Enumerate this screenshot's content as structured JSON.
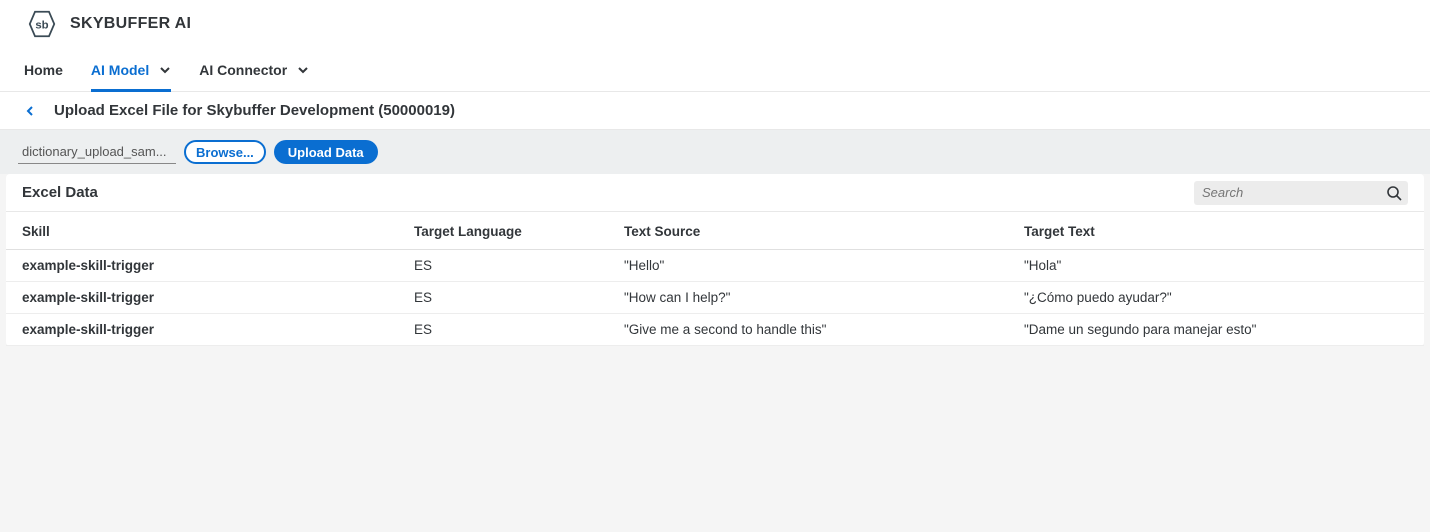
{
  "brand": {
    "title": "SKYBUFFER AI",
    "logo_text": "sb"
  },
  "nav": {
    "home": "Home",
    "ai_model": "AI Model",
    "ai_connector": "AI Connector"
  },
  "page": {
    "title": "Upload Excel File for Skybuffer Development (50000019)"
  },
  "toolbar": {
    "file_name": "dictionary_upload_sam...",
    "browse_label": "Browse...",
    "upload_label": "Upload Data"
  },
  "panel": {
    "title": "Excel Data",
    "search_placeholder": "Search"
  },
  "table": {
    "headers": {
      "skill": "Skill",
      "target_language": "Target Language",
      "text_source": "Text Source",
      "target_text": "Target Text"
    },
    "rows": [
      {
        "skill": "example-skill-trigger",
        "lang": "ES",
        "src": "\"Hello\"",
        "tgt": "\"Hola\""
      },
      {
        "skill": "example-skill-trigger",
        "lang": "ES",
        "src": "\"How can I help?\"",
        "tgt": "\"¿Cómo puedo ayudar?\""
      },
      {
        "skill": "example-skill-trigger",
        "lang": "ES",
        "src": "\"Give me a second to handle this\"",
        "tgt": "\"Dame un segundo para manejar esto\""
      }
    ]
  }
}
